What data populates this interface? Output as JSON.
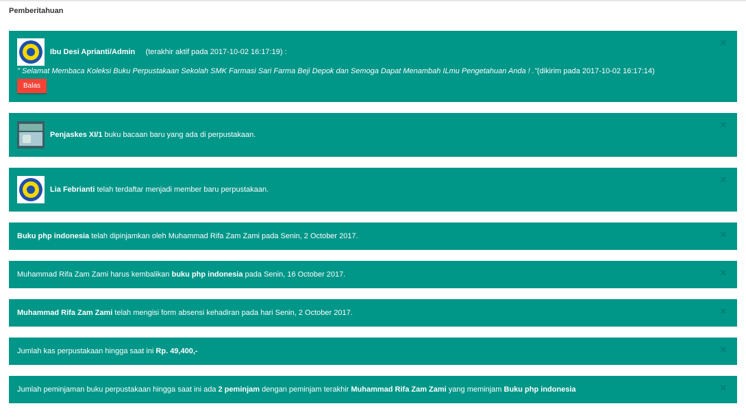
{
  "header": {
    "title": "Pemberitahuan"
  },
  "notifications": [
    {
      "name": "Ibu Desi Aprianti/Admin",
      "status": "(terakhir aktif pada 2017-10-02 16:17:19) :",
      "message": "\" Selamat Membaca Koleksi Buku Perpustakaan Sekolah SMK Farmasi Sari Farma Beji Depok dan Semoga Dapat Menambah ILmu Pengetahuan Anda ! .\"",
      "sent": "(dikirim pada 2017-10-02 16:17:14)",
      "reply_label": "Balas"
    },
    {
      "book": "Penjaskes XI/1",
      "text": "buku bacaan baru yang ada di perpustakaan."
    },
    {
      "member": "Lia Febrianti",
      "text": "telah terdaftar menjadi member baru perpustakaan."
    },
    {
      "book": "Buku php indonesia",
      "text": "telah dipinjamkan oleh Muhammad Rifa Zam Zami pada Senin, 2 October 2017."
    },
    {
      "pre": "Muhammad Rifa Zam Zami harus kembalikan",
      "book": "buku php indonesia",
      "post": "pada Senin, 16 October 2017."
    },
    {
      "name": "Muhammad Rifa Zam Zami",
      "text": "telah mengisi form absensi kehadiran pada hari Senin, 2 October 2017."
    },
    {
      "pre": "Jumlah kas perpustakaan hingga saat ini",
      "amount": "Rp. 49,400,-"
    },
    {
      "pre": "Jumlah peminjaman buku perpustakaan hingga saat ini ada",
      "count": "2 peminjam",
      "mid": "dengan peminjam terakhir",
      "borrower": "Muhammad Rifa Zam Zami",
      "mid2": "yang meminjam",
      "book": "Buku php indonesia"
    }
  ],
  "icons": {
    "close": "close-icon",
    "logo": "school-logo-icon",
    "book_cover": "book-cover-image"
  },
  "colors": {
    "card": "#009688",
    "button": "#f44336",
    "title": "#333333"
  }
}
